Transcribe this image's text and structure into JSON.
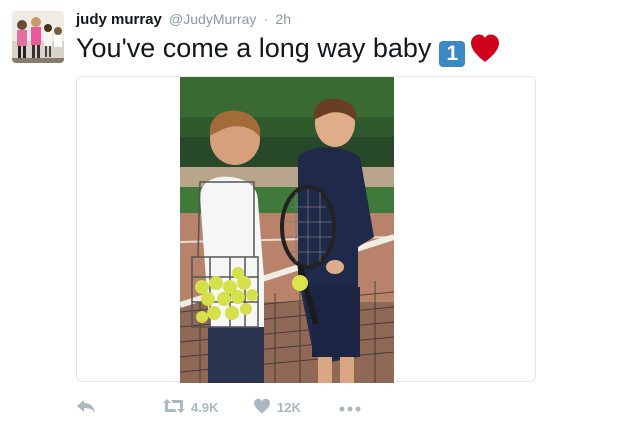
{
  "tweet": {
    "author_name": "judy murray",
    "author_handle": "@JudyMurray",
    "separator": "·",
    "time": "2h",
    "text": "You've come a long way baby",
    "emoji_one_label": "1"
  },
  "actions": {
    "reply": {
      "icon": "reply-icon"
    },
    "retweet": {
      "icon": "retweet-icon",
      "count": "4.9K"
    },
    "like": {
      "icon": "heart-icon",
      "count": "12K"
    },
    "more": {
      "icon": "more-icon"
    }
  },
  "colors": {
    "text": "#14171a",
    "muted": "#8899a6",
    "action": "#aab8c2",
    "emoji_blue": "#3b88c3",
    "emoji_red": "#d0021b"
  }
}
